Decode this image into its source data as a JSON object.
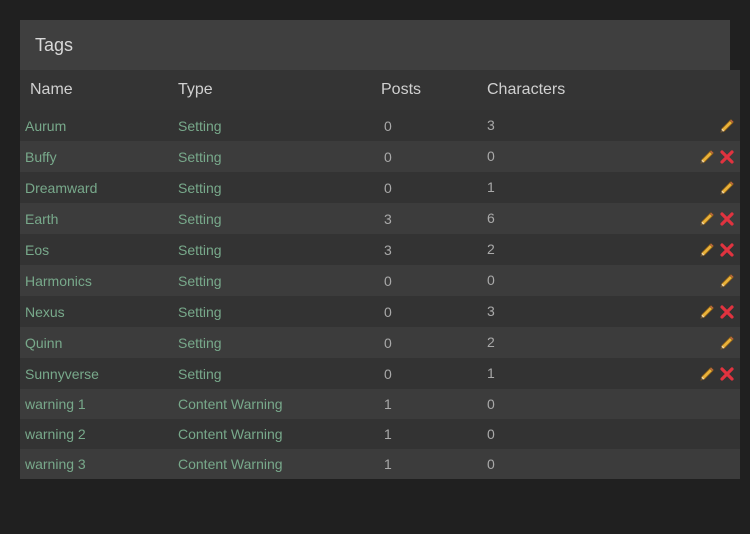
{
  "panel": {
    "title": "Tags"
  },
  "columns": {
    "name": "Name",
    "type": "Type",
    "posts": "Posts",
    "characters": "Characters"
  },
  "colors": {
    "link": "#78a98b",
    "edit": "#e8b23a",
    "delete": "#e0333f"
  },
  "icons": {
    "edit": "pencil-icon",
    "delete": "delete-x-icon"
  },
  "rows": [
    {
      "name": "Aurum",
      "type": "Setting",
      "posts": "0",
      "characters": "3",
      "editable": true,
      "deletable": false
    },
    {
      "name": "Buffy",
      "type": "Setting",
      "posts": "0",
      "characters": "0",
      "editable": true,
      "deletable": true
    },
    {
      "name": "Dreamward",
      "type": "Setting",
      "posts": "0",
      "characters": "1",
      "editable": true,
      "deletable": false
    },
    {
      "name": "Earth",
      "type": "Setting",
      "posts": "3",
      "characters": "6",
      "editable": true,
      "deletable": true
    },
    {
      "name": "Eos",
      "type": "Setting",
      "posts": "3",
      "characters": "2",
      "editable": true,
      "deletable": true
    },
    {
      "name": "Harmonics",
      "type": "Setting",
      "posts": "0",
      "characters": "0",
      "editable": true,
      "deletable": false
    },
    {
      "name": "Nexus",
      "type": "Setting",
      "posts": "0",
      "characters": "3",
      "editable": true,
      "deletable": true
    },
    {
      "name": "Quinn",
      "type": "Setting",
      "posts": "0",
      "characters": "2",
      "editable": true,
      "deletable": false
    },
    {
      "name": "Sunnyverse",
      "type": "Setting",
      "posts": "0",
      "characters": "1",
      "editable": true,
      "deletable": true
    },
    {
      "name": "warning 1",
      "type": "Content Warning",
      "posts": "1",
      "characters": "0",
      "editable": false,
      "deletable": false
    },
    {
      "name": "warning 2",
      "type": "Content Warning",
      "posts": "1",
      "characters": "0",
      "editable": false,
      "deletable": false
    },
    {
      "name": "warning 3",
      "type": "Content Warning",
      "posts": "1",
      "characters": "0",
      "editable": false,
      "deletable": false
    }
  ]
}
